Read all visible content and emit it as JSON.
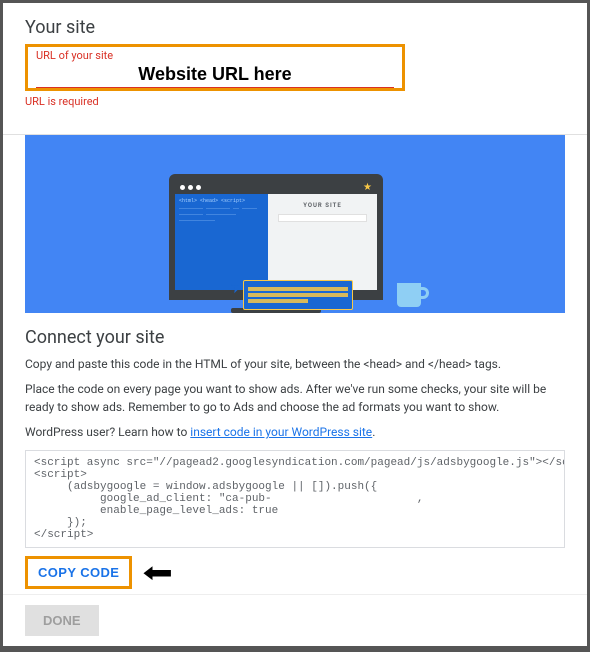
{
  "your_site": {
    "heading": "Your site",
    "url_label": "URL of your site",
    "url_value": "Website URL here",
    "url_error": "URL is required"
  },
  "hero": {
    "preview_label": "YOUR SITE",
    "code_snippet": "<html>\n  <head>\n    <script>\n    ________\n     ________\n      __ _____\n    ________\n  __________\n____________"
  },
  "connect": {
    "heading": "Connect your site",
    "para1": "Copy and paste this code in the HTML of your site, between the <head> and </head> tags.",
    "para2_a": "Place the code on every page you want to show ads. After we've run some checks, your site will be ready to show ads. Remember to go to Ads and choose the ad formats you want to show.",
    "para3_a": "WordPress user? Learn how to ",
    "para3_link": "insert code in your WordPress site",
    "para3_b": ".",
    "code": "<script async src=\"//pagead2.googlesyndication.com/pagead/js/adsbygoogle.js\"></script>\n<script>\n     (adsbygoogle = window.adsbygoogle || []).push({\n          google_ad_client: \"ca-pub-                      ,\n          enable_page_level_ads: true\n     });\n</script>",
    "copy_label": "COPY CODE"
  },
  "footer": {
    "done_label": "DONE"
  }
}
